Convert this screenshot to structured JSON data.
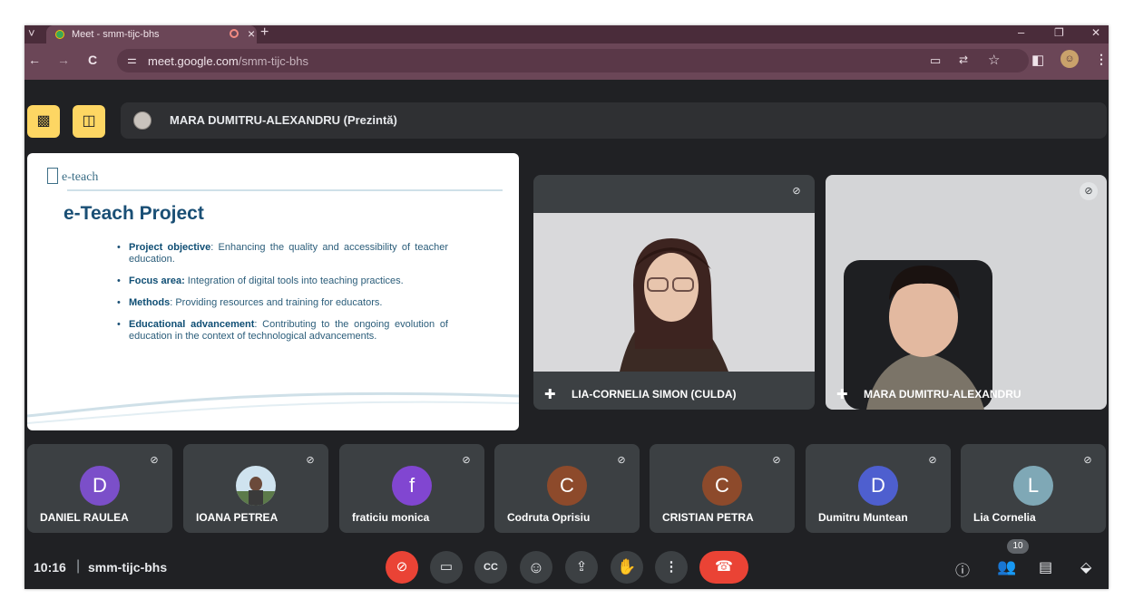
{
  "browser": {
    "tab_title": "Meet - smm-tijc-bhs",
    "tab_close": "×",
    "new_tab": "+",
    "tab_list": "˅",
    "url_domain": "meet.google.com",
    "url_path": "/smm-tijc-bhs",
    "window_controls": {
      "minimize": "–",
      "restore": "❐",
      "close": "✕"
    },
    "nav": {
      "back": "←",
      "forward": "→",
      "reload": "C"
    }
  },
  "presenter_bar": {
    "name": "MARA DUMITRU-ALEXANDRU (Prezintă)"
  },
  "slide": {
    "logo_text": "e-teach",
    "title": "e-Teach Project",
    "bullets": [
      {
        "key": "Project objective",
        "text": ": Enhancing the quality and accessibility of teacher education."
      },
      {
        "key": "Focus area:",
        "text": " Integration of digital tools into teaching practices."
      },
      {
        "key": "Methods",
        "text": ": Providing resources and training for educators."
      },
      {
        "key": "Educational advancement",
        "text": ": Contributing to the ongoing evolution of education in the context of technological advancements."
      }
    ]
  },
  "tiles": [
    {
      "name": "LIA-CORNELIA SIMON (CULDA)"
    },
    {
      "name": "MARA DUMITRU-ALEXANDRU"
    }
  ],
  "participants": [
    {
      "name": "DANIEL RAULEA",
      "initial": "D",
      "color": "#7b4fc9"
    },
    {
      "name": "IOANA PETREA",
      "initial": "",
      "color": "#cfe3ef"
    },
    {
      "name": "fraticiu monica",
      "initial": "f",
      "color": "#8146d1"
    },
    {
      "name": "Codruta Oprisiu",
      "initial": "C",
      "color": "#8d4a2b"
    },
    {
      "name": "CRISTIAN PETRA",
      "initial": "C",
      "color": "#8d4a2b"
    },
    {
      "name": "Dumitru Muntean",
      "initial": "D",
      "color": "#4e5fcf"
    },
    {
      "name": "Lia Cornelia",
      "initial": "L",
      "color": "#7fa8b6"
    }
  ],
  "bottom": {
    "time": "10:16",
    "separator": "|",
    "meeting_code": "smm-tijc-bhs",
    "people_count": "10"
  }
}
